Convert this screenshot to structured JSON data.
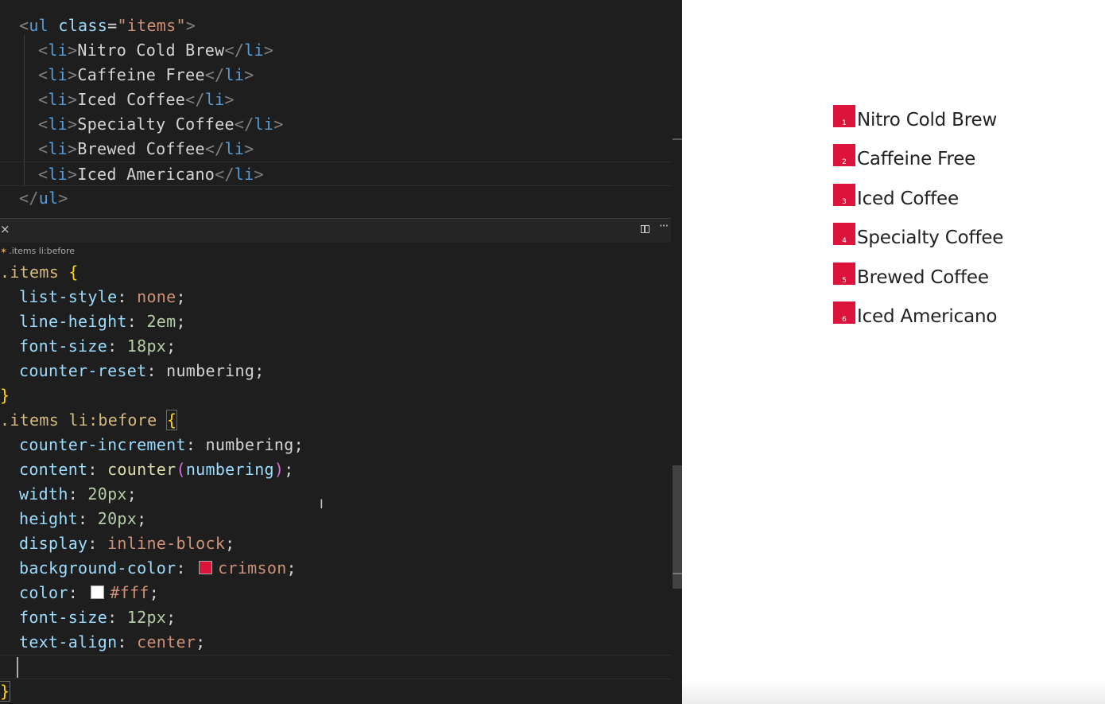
{
  "editor": {
    "html_lines": [
      {
        "indent": "",
        "open": "<",
        "tag": "ul",
        "attr": "class",
        "eq": "=",
        "str": "\"items\"",
        "close": ">"
      },
      {
        "indent": "  ",
        "open": "<",
        "tag": "li",
        "close": ">",
        "text": "Nitro Cold Brew",
        "end_open": "</",
        "end_tag": "li",
        "end_close": ">"
      },
      {
        "indent": "  ",
        "open": "<",
        "tag": "li",
        "close": ">",
        "text": "Caffeine Free",
        "end_open": "</",
        "end_tag": "li",
        "end_close": ">"
      },
      {
        "indent": "  ",
        "open": "<",
        "tag": "li",
        "close": ">",
        "text": "Iced Coffee",
        "end_open": "</",
        "end_tag": "li",
        "end_close": ">"
      },
      {
        "indent": "  ",
        "open": "<",
        "tag": "li",
        "close": ">",
        "text": "Specialty Coffee",
        "end_open": "</",
        "end_tag": "li",
        "end_close": ">"
      },
      {
        "indent": "  ",
        "open": "<",
        "tag": "li",
        "close": ">",
        "text": "Brewed Coffee",
        "end_open": "</",
        "end_tag": "li",
        "end_close": ">"
      },
      {
        "indent": "  ",
        "open": "<",
        "tag": "li",
        "close": ">",
        "text": "Iced Americano",
        "end_open": "</",
        "end_tag": "li",
        "end_close": ">"
      },
      {
        "indent": "",
        "open": "</",
        "tag": "ul",
        "close": ">"
      }
    ],
    "tab_close": "×",
    "more_icon": "···",
    "breadcrumb": ".items li:before",
    "css": {
      "rule1_selector": ".items",
      "open_brace": "{",
      "close_brace": "}",
      "rule1": [
        {
          "prop": "list-style",
          "value": "none"
        },
        {
          "prop": "line-height",
          "value": "2em"
        },
        {
          "prop": "font-size",
          "value": "18px"
        },
        {
          "prop": "counter-reset",
          "value": "numbering"
        }
      ],
      "rule2_selector": ".items li:before",
      "rule2": {
        "counter_increment": {
          "prop": "counter-increment",
          "value": "numbering"
        },
        "content": {
          "prop": "content",
          "fn": "counter",
          "paren_open": "(",
          "arg": "numbering",
          "paren_close": ")"
        },
        "width": {
          "prop": "width",
          "value": "20px"
        },
        "height": {
          "prop": "height",
          "value": "20px"
        },
        "display": {
          "prop": "display",
          "value": "inline-block"
        },
        "background_color": {
          "prop": "background-color",
          "value": "crimson",
          "swatch": "#dc143c"
        },
        "color": {
          "prop": "color",
          "value": "#fff",
          "swatch": "#ffffff"
        },
        "font_size": {
          "prop": "font-size",
          "value": "12px"
        },
        "text_align": {
          "prop": "text-align",
          "value": "center"
        }
      }
    },
    "ibeam": "I"
  },
  "preview": {
    "items": [
      {
        "num": "1",
        "label": "Nitro Cold Brew"
      },
      {
        "num": "2",
        "label": "Caffeine Free"
      },
      {
        "num": "3",
        "label": "Iced Coffee"
      },
      {
        "num": "4",
        "label": "Specialty Coffee"
      },
      {
        "num": "5",
        "label": "Brewed Coffee"
      },
      {
        "num": "6",
        "label": "Iced Americano"
      }
    ],
    "badge_color": "#dc143c"
  }
}
